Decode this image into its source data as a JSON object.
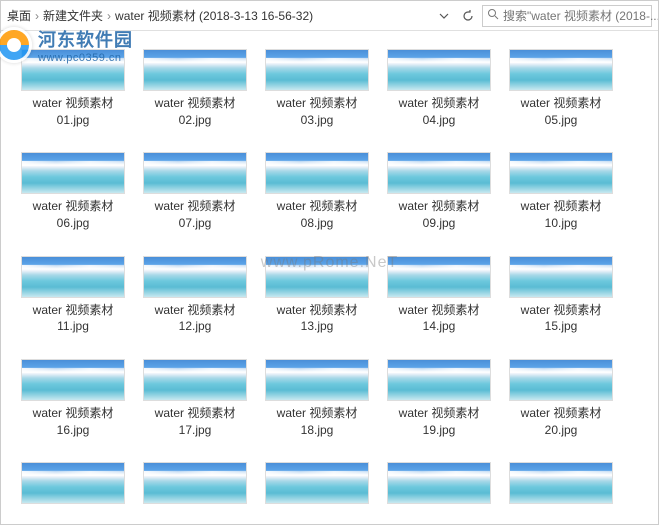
{
  "breadcrumb": {
    "items": [
      "桌面",
      "新建文件夹",
      "water 视频素材 (2018-3-13 16-56-32)"
    ]
  },
  "search": {
    "placeholder": "搜索\"water 视频素材 (2018-..."
  },
  "watermark": {
    "title": "河东软件园",
    "url": "www.pc0359.cn",
    "center": "www.pRome.NeT"
  },
  "files": [
    {
      "name_line1": "water 视频素材",
      "name_line2": "01.jpg"
    },
    {
      "name_line1": "water 视频素材",
      "name_line2": "02.jpg"
    },
    {
      "name_line1": "water 视频素材",
      "name_line2": "03.jpg"
    },
    {
      "name_line1": "water 视频素材",
      "name_line2": "04.jpg"
    },
    {
      "name_line1": "water 视频素材",
      "name_line2": "05.jpg"
    },
    {
      "name_line1": "water 视频素材",
      "name_line2": "06.jpg"
    },
    {
      "name_line1": "water 视频素材",
      "name_line2": "07.jpg"
    },
    {
      "name_line1": "water 视频素材",
      "name_line2": "08.jpg"
    },
    {
      "name_line1": "water 视频素材",
      "name_line2": "09.jpg"
    },
    {
      "name_line1": "water 视频素材",
      "name_line2": "10.jpg"
    },
    {
      "name_line1": "water 视频素材",
      "name_line2": "11.jpg"
    },
    {
      "name_line1": "water 视频素材",
      "name_line2": "12.jpg"
    },
    {
      "name_line1": "water 视频素材",
      "name_line2": "13.jpg"
    },
    {
      "name_line1": "water 视频素材",
      "name_line2": "14.jpg"
    },
    {
      "name_line1": "water 视频素材",
      "name_line2": "15.jpg"
    },
    {
      "name_line1": "water 视频素材",
      "name_line2": "16.jpg"
    },
    {
      "name_line1": "water 视频素材",
      "name_line2": "17.jpg"
    },
    {
      "name_line1": "water 视频素材",
      "name_line2": "18.jpg"
    },
    {
      "name_line1": "water 视频素材",
      "name_line2": "19.jpg"
    },
    {
      "name_line1": "water 视频素材",
      "name_line2": "20.jpg"
    },
    {
      "name_line1": "",
      "name_line2": ""
    },
    {
      "name_line1": "",
      "name_line2": ""
    },
    {
      "name_line1": "",
      "name_line2": ""
    },
    {
      "name_line1": "",
      "name_line2": ""
    },
    {
      "name_line1": "",
      "name_line2": ""
    }
  ]
}
